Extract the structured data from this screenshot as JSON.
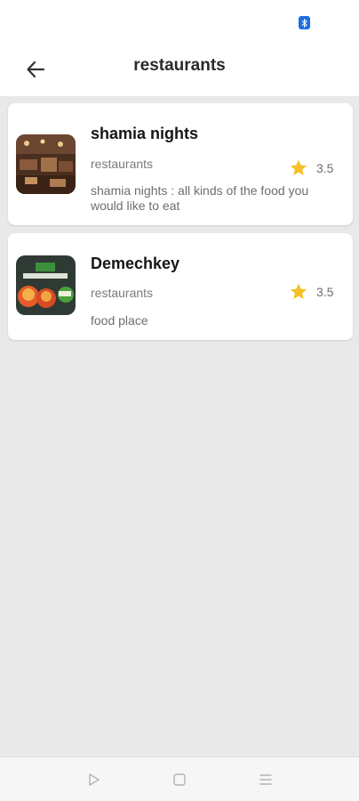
{
  "header": {
    "title": "restaurants",
    "back_icon": "arrow-left-icon"
  },
  "colors": {
    "star": "#f5c12a",
    "background": "#e9e9e9",
    "card": "#ffffff"
  },
  "restaurants": [
    {
      "name": "shamia nights",
      "category": "restaurants",
      "rating": "3.5",
      "description": "shamia nights : all kinds of the food you would like to eat"
    },
    {
      "name": "Demechkey",
      "category": "restaurants",
      "rating": "3.5",
      "description": "food place"
    }
  ],
  "system_nav": {
    "icons": [
      "back-triangle-icon",
      "home-square-icon",
      "recents-menu-icon"
    ]
  }
}
